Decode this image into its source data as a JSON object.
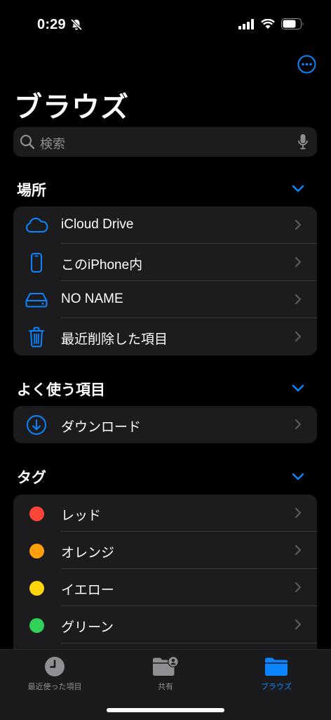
{
  "status": {
    "time": "0:29",
    "battery_level": 0.75
  },
  "header": {
    "title": "ブラウズ",
    "more_icon": "ellipsis-circle-icon"
  },
  "search": {
    "placeholder": "検索"
  },
  "locations": {
    "title": "場所",
    "items": [
      {
        "label": "iCloud Drive",
        "icon": "icloud-icon"
      },
      {
        "label": "このiPhone内",
        "icon": "iphone-icon"
      },
      {
        "label": "NO NAME",
        "icon": "external-drive-icon"
      },
      {
        "label": "最近削除した項目",
        "icon": "trash-icon"
      }
    ]
  },
  "favorites": {
    "title": "よく使う項目",
    "items": [
      {
        "label": "ダウンロード",
        "icon": "download-icon"
      }
    ]
  },
  "tags": {
    "title": "タグ",
    "items": [
      {
        "label": "レッド",
        "color": "#ff453a"
      },
      {
        "label": "オレンジ",
        "color": "#ff9f0a"
      },
      {
        "label": "イエロー",
        "color": "#ffd60a"
      },
      {
        "label": "グリーン",
        "color": "#30d158"
      }
    ]
  },
  "tabbar": {
    "items": [
      {
        "label": "最近使った項目",
        "icon": "clock-icon",
        "active": false
      },
      {
        "label": "共有",
        "icon": "shared-folder-icon",
        "active": false
      },
      {
        "label": "ブラウズ",
        "icon": "folder-icon",
        "active": true
      }
    ]
  },
  "colors": {
    "accent": "#0a84ff",
    "background": "#000000",
    "cell": "#1c1c1e"
  }
}
